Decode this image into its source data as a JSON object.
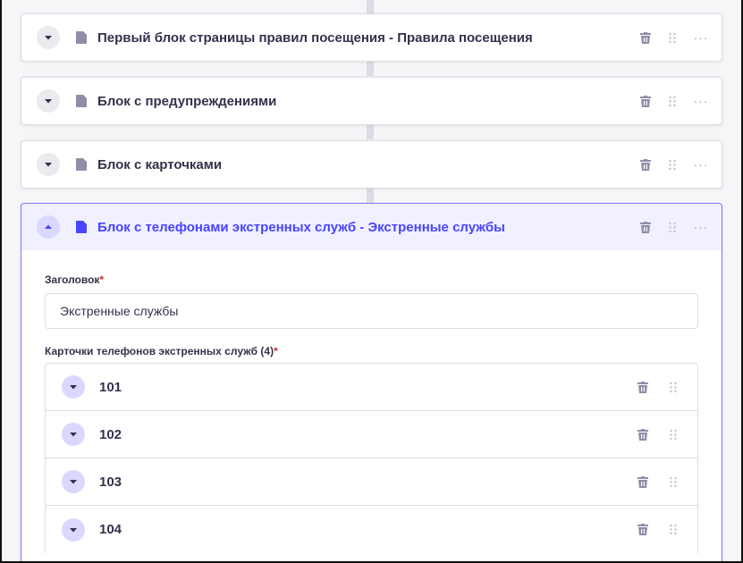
{
  "blocks": [
    {
      "title": "Первый блок страницы правил посещения - Правила посещения",
      "expanded": false
    },
    {
      "title": "Блок с предупреждениями",
      "expanded": false
    },
    {
      "title": "Блок с карточками",
      "expanded": false
    },
    {
      "title": "Блок с телефонами экстренных служб - Экстренные службы",
      "expanded": true
    }
  ],
  "expanded_block": {
    "heading_field": {
      "label": "Заголовок",
      "required_mark": "*",
      "value": "Экстренные службы"
    },
    "cards_field": {
      "label": "Карточки телефонов экстренных служб (4)",
      "required_mark": "*",
      "items": [
        "101",
        "102",
        "103",
        "104"
      ]
    }
  },
  "more_glyph": "···",
  "icons": {
    "toggle_collapsed": "chevron-down-icon",
    "toggle_expanded": "chevron-up-icon",
    "document": "document-icon",
    "delete": "trash-icon",
    "drag": "drag-handle-icon",
    "more": "more-icon"
  },
  "colors": {
    "accent": "#4945ff",
    "accent_light": "#f0f0ff",
    "accent_border": "#7b79ff",
    "required": "#d02b20",
    "text": "#32324d",
    "muted_icon": "#8e8ea9",
    "background": "#f6f6f9"
  }
}
